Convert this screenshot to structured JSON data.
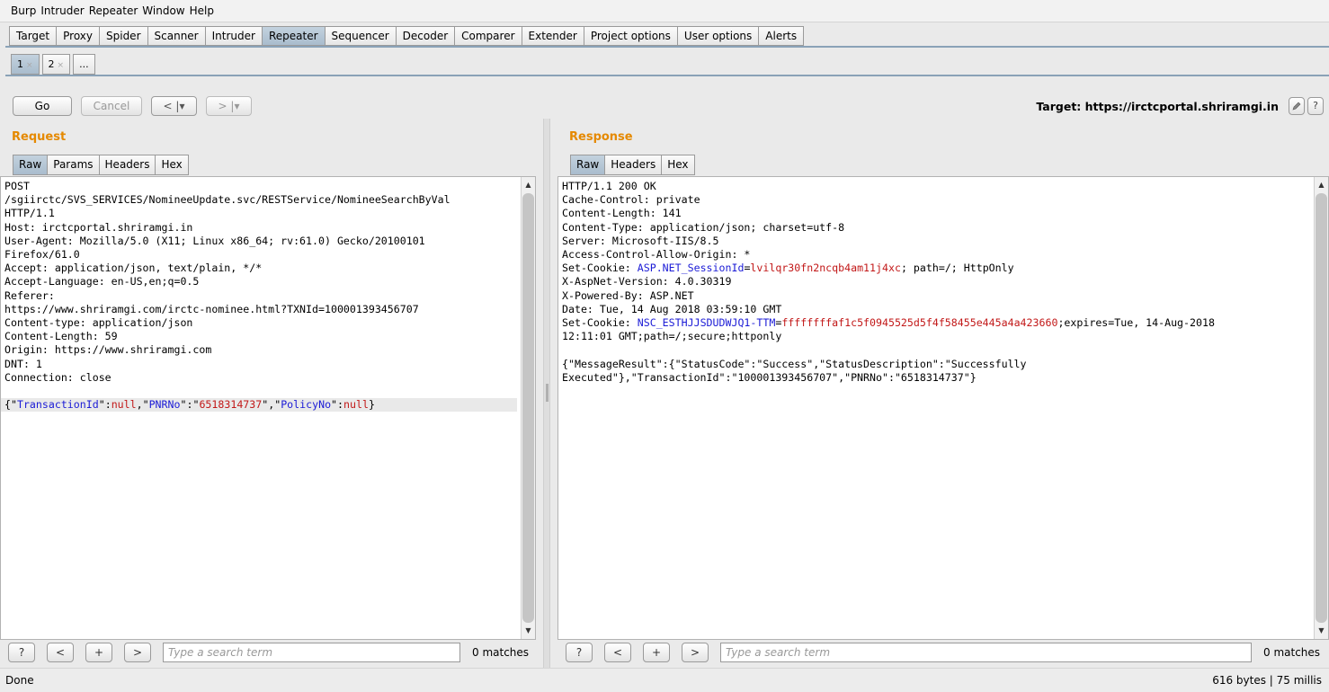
{
  "menubar": {
    "items": [
      "Burp",
      "Intruder",
      "Repeater",
      "Window",
      "Help"
    ]
  },
  "main_tabs": [
    "Target",
    "Proxy",
    "Spider",
    "Scanner",
    "Intruder",
    "Repeater",
    "Sequencer",
    "Decoder",
    "Comparer",
    "Extender",
    "Project options",
    "User options",
    "Alerts"
  ],
  "active_main_tab": "Repeater",
  "sub_tabs": [
    {
      "label": "1",
      "close": "×"
    },
    {
      "label": "2",
      "close": "×"
    }
  ],
  "sub_tab_more": "...",
  "toolbar": {
    "go": "Go",
    "cancel": "Cancel",
    "back": "< |▾",
    "forward": "> |▾"
  },
  "target": {
    "label": "Target: https://irctcportal.shriramgi.in",
    "edit_icon": "pencil-icon",
    "help_icon": "?"
  },
  "request": {
    "title": "Request",
    "tabs": [
      "Raw",
      "Params",
      "Headers",
      "Hex"
    ],
    "lines": [
      "POST",
      "/sgiirctc/SVS_SERVICES/NomineeUpdate.svc/RESTService/NomineeSearchByVal",
      "HTTP/1.1",
      "Host: irctcportal.shriramgi.in",
      "User-Agent: Mozilla/5.0 (X11; Linux x86_64; rv:61.0) Gecko/20100101",
      "Firefox/61.0",
      "Accept: application/json, text/plain, */*",
      "Accept-Language: en-US,en;q=0.5",
      "Referer:",
      "https://www.shriramgi.com/irctc-nominee.html?TXNId=100001393456707",
      "Content-type: application/json",
      "Content-Length: 59",
      "Origin: https://www.shriramgi.com",
      "DNT: 1",
      "Connection: close",
      ""
    ],
    "body": {
      "p1": "{\"",
      "k1": "TransactionId",
      "p2": "\":",
      "v1": "null",
      "p3": ",\"",
      "k2": "PNRNo",
      "p4": "\":\"",
      "v2": "6518314737",
      "p5": "\",\"",
      "k3": "PolicyNo",
      "p6": "\":",
      "v3": "null",
      "p7": "}"
    }
  },
  "response": {
    "title": "Response",
    "tabs": [
      "Raw",
      "Headers",
      "Hex"
    ],
    "lines_a": [
      "HTTP/1.1 200 OK",
      "Cache-Control: private",
      "Content-Length: 141",
      "Content-Type: application/json; charset=utf-8",
      "Server: Microsoft-IIS/8.5",
      "Access-Control-Allow-Origin: *"
    ],
    "cookie1": {
      "prefix": "Set-Cookie: ",
      "name": "ASP.NET_SessionId",
      "eq": "=",
      "value": "lvilqr30fn2ncqb4am11j4xc",
      "suffix": "; path=/; HttpOnly"
    },
    "lines_b": [
      "X-AspNet-Version: 4.0.30319",
      "X-Powered-By: ASP.NET",
      "Date: Tue, 14 Aug 2018 03:59:10 GMT"
    ],
    "cookie2": {
      "prefix": "Set-Cookie: ",
      "name": "NSC_ESTHJJSDUDWJQ1-TTM",
      "eq": "=",
      "value": "ffffffffaf1c5f0945525d5f4f58455e445a4a423660",
      "suffix": ";expires=Tue, 14-Aug-2018",
      "cont": "12:11:01 GMT;path=/;secure;httponly"
    },
    "body_lines": [
      "",
      "{\"MessageResult\":{\"StatusCode\":\"Success\",\"StatusDescription\":\"Successfully",
      "Executed\"},\"TransactionId\":\"100001393456707\",\"PNRNo\":\"6518314737\"}"
    ]
  },
  "search": {
    "help": "?",
    "prev": "<",
    "add": "+",
    "next": ">",
    "placeholder": "Type a search term",
    "request_matches": "0 matches",
    "response_matches": "0 matches"
  },
  "status": {
    "left": "Done",
    "right": "616 bytes | 75 millis"
  }
}
